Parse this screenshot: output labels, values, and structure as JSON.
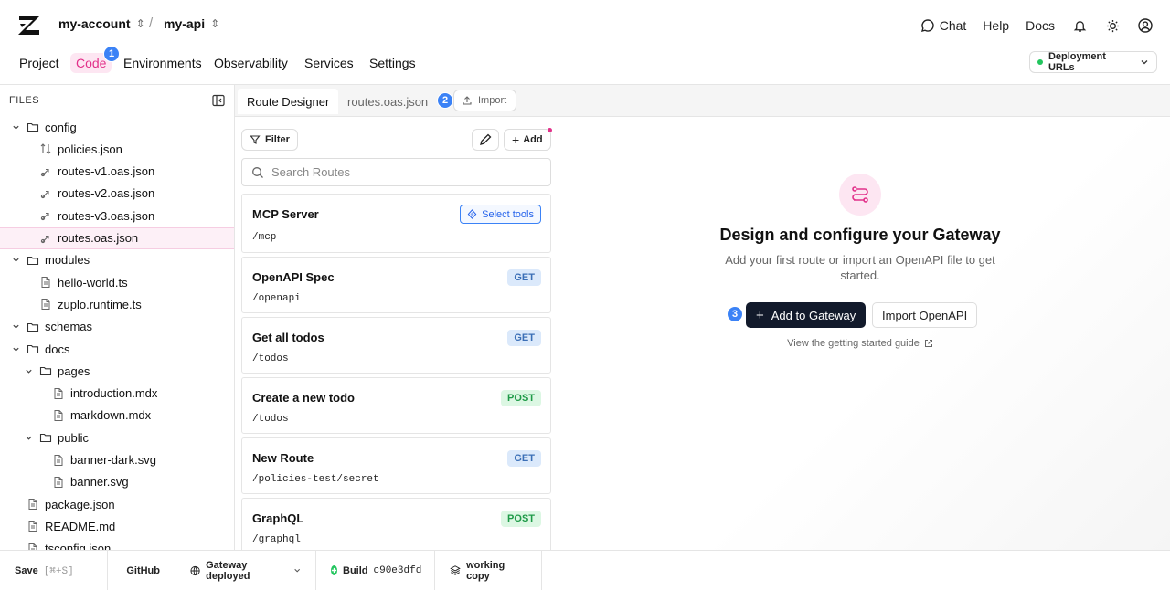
{
  "header": {
    "account": "my-account",
    "api": "my-api",
    "chat": "Chat",
    "help": "Help",
    "docs": "Docs"
  },
  "nav": {
    "tabs": [
      "Project",
      "Code",
      "Environments",
      "Observability",
      "Services",
      "Settings"
    ],
    "active": "Code",
    "code_badge": "1",
    "deployment_urls": "Deployment URLs"
  },
  "sidebar": {
    "header": "FILES",
    "tree": [
      {
        "label": "config",
        "type": "folder"
      },
      {
        "label": "policies.json",
        "type": "file"
      },
      {
        "label": "routes-v1.oas.json",
        "type": "route"
      },
      {
        "label": "routes-v2.oas.json",
        "type": "route"
      },
      {
        "label": "routes-v3.oas.json",
        "type": "route"
      },
      {
        "label": "routes.oas.json",
        "type": "route",
        "selected": true
      },
      {
        "label": "modules",
        "type": "folder"
      },
      {
        "label": "hello-world.ts",
        "type": "file"
      },
      {
        "label": "zuplo.runtime.ts",
        "type": "file"
      },
      {
        "label": "schemas",
        "type": "folder"
      },
      {
        "label": "docs",
        "type": "folder"
      },
      {
        "label": "pages",
        "type": "folder"
      },
      {
        "label": "introduction.mdx",
        "type": "file"
      },
      {
        "label": "markdown.mdx",
        "type": "file"
      },
      {
        "label": "public",
        "type": "folder"
      },
      {
        "label": "banner-dark.svg",
        "type": "file"
      },
      {
        "label": "banner.svg",
        "type": "file"
      },
      {
        "label": "package.json",
        "type": "file"
      },
      {
        "label": "README.md",
        "type": "file"
      },
      {
        "label": "tsconfig.json",
        "type": "file"
      }
    ]
  },
  "editor": {
    "tabs": [
      "Route Designer",
      "routes.oas.json"
    ],
    "import_badge": "2",
    "import_label": "Import"
  },
  "routes": {
    "filter_label": "Filter",
    "add_label": "Add",
    "search_placeholder": "Search Routes",
    "select_tools": "Select tools",
    "items": [
      {
        "name": "MCP Server",
        "path": "/mcp",
        "method": ""
      },
      {
        "name": "OpenAPI Spec",
        "path": "/openapi",
        "method": "GET"
      },
      {
        "name": "Get all todos",
        "path": "/todos",
        "method": "GET"
      },
      {
        "name": "Create a new todo",
        "path": "/todos",
        "method": "POST"
      },
      {
        "name": "New Route",
        "path": "/policies-test/secret",
        "method": "GET"
      },
      {
        "name": "GraphQL",
        "path": "/graphql",
        "method": "POST"
      }
    ]
  },
  "empty_state": {
    "title": "Design and configure your Gateway",
    "subtitle": "Add your first route or import an OpenAPI file to get started.",
    "primary_badge": "3",
    "primary": "Add to Gateway",
    "secondary": "Import OpenAPI",
    "guide_link": "View the getting started guide"
  },
  "statusbar": {
    "save": "Save",
    "save_shortcut": "[⌘+S]",
    "github": "GitHub",
    "gateway": "Gateway deployed",
    "build_label": "Build",
    "build_hash": "c90e3dfd",
    "working_copy": "working copy"
  },
  "colors": {
    "accent": "#e2318a",
    "badge": "#3b82f6",
    "get": "#3b6fb6",
    "post": "#1f9a48",
    "primary_button": "#121a2b"
  }
}
